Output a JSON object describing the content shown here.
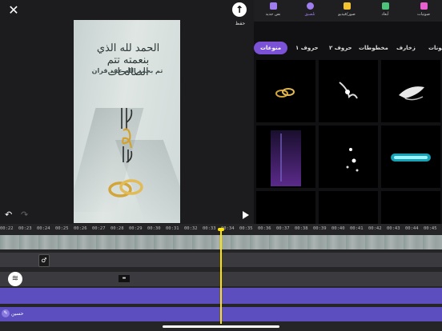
{
  "header": {
    "close_icon": "close-icon",
    "save_label": "حفظ"
  },
  "preview": {
    "calligraphy_text": "الحمد لله الذي بنعمته تتم الصالحات",
    "subtitle": "تم بحمد الله عقد قران"
  },
  "tabs": [
    {
      "label": "صوتيات",
      "icon": "music-icon",
      "color": "#e85fd0"
    },
    {
      "label": "أبعاد",
      "icon": "dimensions-icon",
      "color": "#4cc27a"
    },
    {
      "label": "صور/فيديو",
      "icon": "media-icon",
      "color": "#f2c230"
    },
    {
      "label": "تلصيق",
      "icon": "sticker-icon",
      "color": "#9f7cf0",
      "active": true
    },
    {
      "label": "نص جديد",
      "icon": "text-icon",
      "color": "#9f7cf0"
    }
  ],
  "categories": [
    "منوعات",
    "حروف ١",
    "حروف ٢",
    "مخطوطات",
    "زخارف",
    "ملونات"
  ],
  "timeline": {
    "ticks": [
      "00:22",
      "00:23",
      "00:24",
      "00:25",
      "00:26",
      "00:27",
      "00:28",
      "00:29",
      "00:30",
      "00:31",
      "00:32",
      "00:33",
      "00:34",
      "00:35",
      "00:36",
      "00:37",
      "00:38",
      "00:39",
      "00:40",
      "00:41",
      "00:42",
      "00:43",
      "00:44",
      "00:45"
    ],
    "text_clip_label": "حسين"
  },
  "colors": {
    "accent": "#7b52d6",
    "playhead": "#ffe400",
    "track_purple": "#5d4ec0"
  }
}
